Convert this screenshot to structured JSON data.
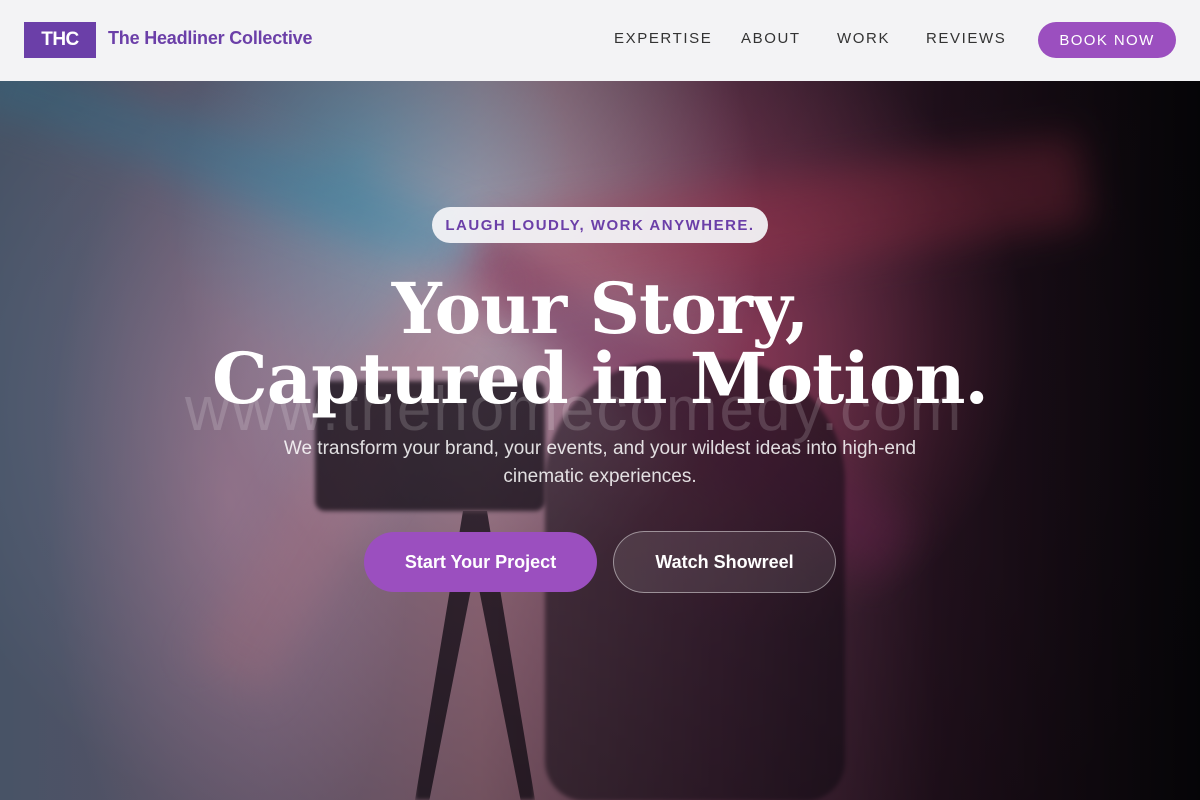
{
  "header": {
    "logo_text": "THC",
    "brand_name": "The Headliner Collective",
    "nav": [
      {
        "label": "EXPERTISE"
      },
      {
        "label": "ABOUT"
      },
      {
        "label": "WORK"
      },
      {
        "label": "REVIEWS"
      }
    ],
    "cta_label": "BOOK NOW"
  },
  "hero": {
    "tagline": "LAUGH LOUDLY, WORK ANYWHERE.",
    "headline_line1": "Your Story,",
    "headline_line2": "Captured in Motion.",
    "watermark": "www.thehomecomedy.com",
    "subtitle": "We transform your brand, your events, and your wildest ideas into high-end cinematic experiences.",
    "primary_button": "Start Your Project",
    "secondary_button": "Watch Showreel"
  },
  "colors": {
    "brand_purple": "#6b3fa8",
    "accent_purple": "#9b4fbf",
    "header_bg": "#f3f3f5"
  }
}
